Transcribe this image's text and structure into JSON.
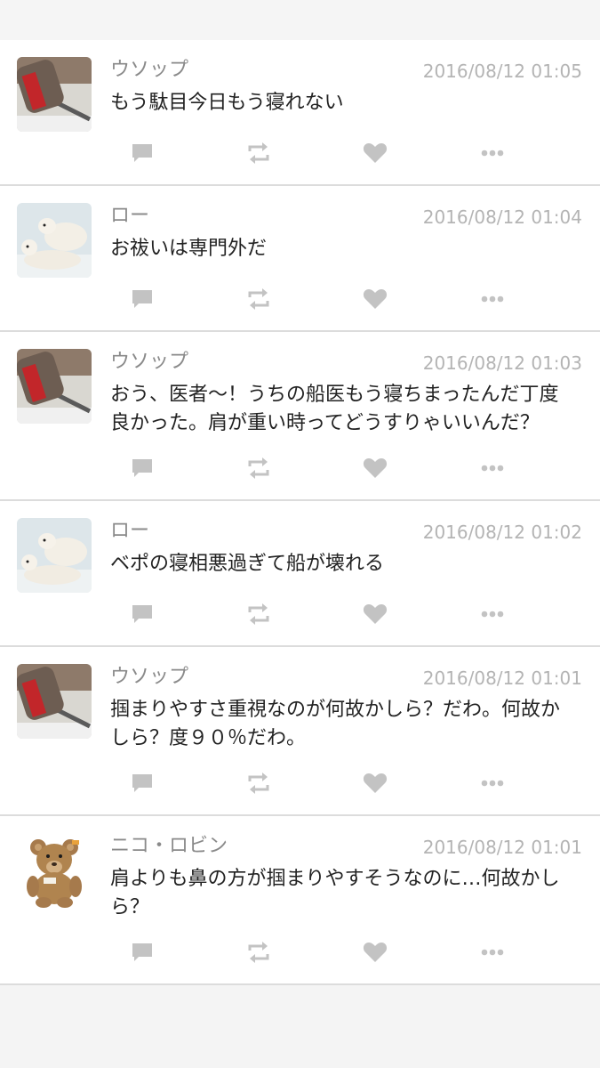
{
  "posts": [
    {
      "author": "ウソップ",
      "time": "2016/08/12 01:05",
      "text": "もう駄目今日もう寝れない",
      "avatar": "hammer-avatar"
    },
    {
      "author": "ロー",
      "time": "2016/08/12 01:04",
      "text": "お祓いは専門外だ",
      "avatar": "polar-bear-avatar"
    },
    {
      "author": "ウソップ",
      "time": "2016/08/12 01:03",
      "text": "おう、医者〜！うちの船医もう寝ちまったんだ丁度良かった。肩が重い時ってどうすりゃいいんだ？",
      "avatar": "hammer-avatar"
    },
    {
      "author": "ロー",
      "time": "2016/08/12 01:02",
      "text": "ベポの寝相悪過ぎて船が壊れる",
      "avatar": "polar-bear-avatar"
    },
    {
      "author": "ウソップ",
      "time": "2016/08/12 01:01",
      "text": "掴まりやすさ重視なのが何故かしら？だわ。何故かしら？度９０％だわ。",
      "avatar": "hammer-avatar"
    },
    {
      "author": "ニコ・ロビン",
      "time": "2016/08/12 01:01",
      "text": "肩よりも鼻の方が掴まりやすそうなのに…何故かしら？",
      "avatar": "teddy-bear-avatar"
    }
  ],
  "icons": {
    "reply": "speech-bubble-icon",
    "retweet": "retweet-icon",
    "like": "heart-icon",
    "more": "more-dots-icon"
  },
  "colors": {
    "background": "#f4f4f4",
    "card": "#ffffff",
    "author": "#8a8a8a",
    "time": "#b4b4b4",
    "text": "#222222",
    "icon": "#c3c3c3",
    "divider": "#dcdcdc"
  }
}
